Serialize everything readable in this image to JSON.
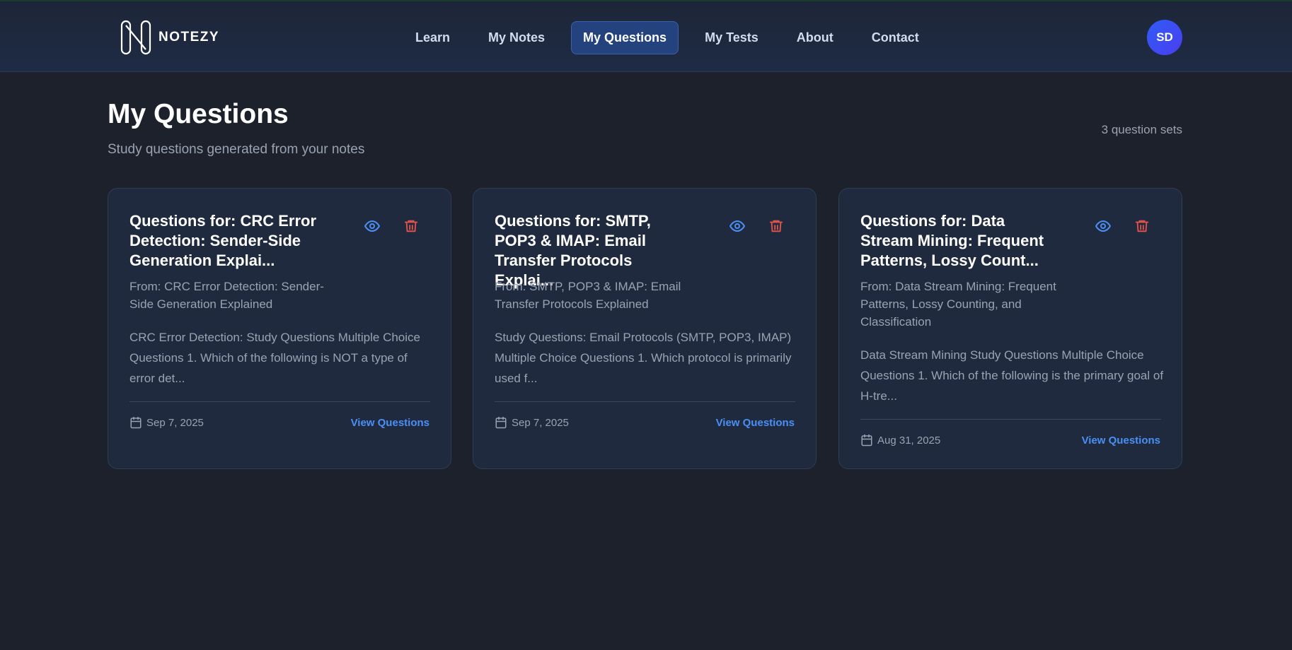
{
  "app": {
    "name": "NOTEZY"
  },
  "nav": {
    "items": [
      {
        "label": "Learn",
        "active": false
      },
      {
        "label": "My Notes",
        "active": false
      },
      {
        "label": "My Questions",
        "active": true
      },
      {
        "label": "My Tests",
        "active": false
      },
      {
        "label": "About",
        "active": false
      },
      {
        "label": "Contact",
        "active": false
      }
    ],
    "avatar_initials": "SD"
  },
  "page": {
    "title": "My Questions",
    "subtitle": "Study questions generated from your notes",
    "count_label": "3 question sets"
  },
  "cards": [
    {
      "title": "Questions for: CRC Error Detection: Sender-Side Generation Explai...",
      "source": "From: CRC Error Detection: Sender-Side Generation Explained",
      "excerpt": "CRC Error Detection: Study Questions Multiple Choice Questions 1. Which of the following is NOT a type of error det...",
      "date": "Sep 7, 2025",
      "link_label": "View Questions"
    },
    {
      "title": "Questions for: SMTP, POP3 & IMAP: Email Transfer Protocols Explai...",
      "source": "From: SMTP, POP3 & IMAP: Email Transfer Protocols Explained",
      "excerpt": "Study Questions: Email Protocols (SMTP, POP3, IMAP) Multiple Choice Questions 1. Which protocol is primarily used f...",
      "date": "Sep 7, 2025",
      "link_label": "View Questions"
    },
    {
      "title": "Questions for: Data Stream Mining: Frequent Patterns, Lossy Count...",
      "source": "From: Data Stream Mining: Frequent Patterns, Lossy Counting, and Classification",
      "excerpt": "Data Stream Mining Study Questions Multiple Choice Questions 1. Which of the following is the primary goal of H-tre...",
      "date": "Aug 31, 2025",
      "link_label": "View Questions"
    }
  ],
  "colors": {
    "background": "#1c212b",
    "card_background": "#1f2a3e",
    "accent_blue": "#4b8ff5",
    "delete_red": "#e5534b",
    "nav_active": "#24427d"
  },
  "icons": {
    "view": "eye-icon",
    "delete": "trash-icon",
    "date": "calendar-icon"
  }
}
